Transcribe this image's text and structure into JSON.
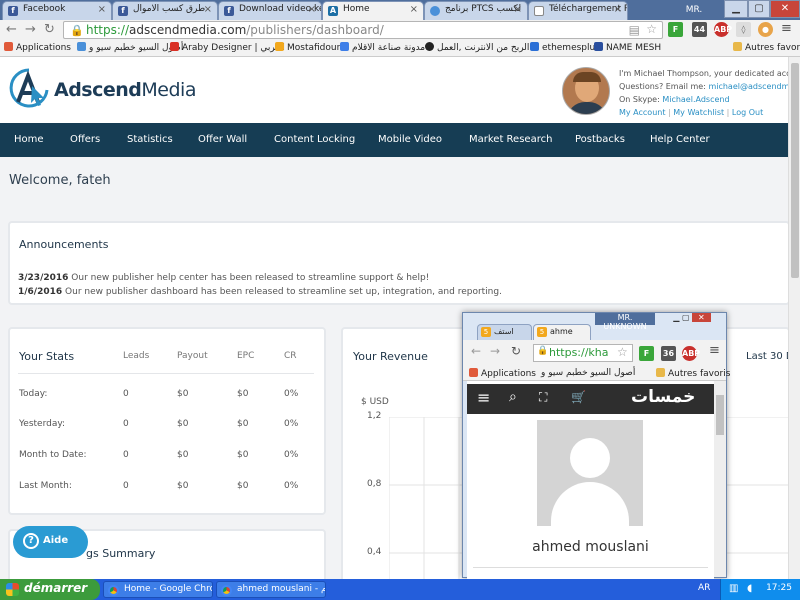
{
  "browser": {
    "tabs": [
      {
        "title": "Facebook",
        "icon": "facebook-icon",
        "color": "#3b5998"
      },
      {
        "title": "طرق كسب الاموال",
        "icon": "facebook-icon",
        "color": "#3b5998"
      },
      {
        "title": "Download video ke",
        "icon": "facebook-icon",
        "color": "#3b5998"
      },
      {
        "title": "Home",
        "icon": "adscend-icon",
        "color": "#1d6fa5"
      },
      {
        "title": "برنامج PTCS لكسب",
        "icon": "globe-icon",
        "color": "#4a90d9"
      },
      {
        "title": "Téléchargement PT",
        "icon": "page-icon",
        "color": "#888888"
      }
    ],
    "user_badge": "MR. UNKNOWN",
    "url_scheme": "https://",
    "url_host": "adscendmedia.com",
    "url_path": "/publishers/dashboard/",
    "extensions": [
      {
        "label": "F",
        "color": "#3aa63a"
      },
      {
        "label": "44",
        "color": "#555555"
      },
      {
        "label": "ABP",
        "color": "#c9302c"
      }
    ],
    "bookmarks": [
      {
        "label": "Applications",
        "color": "#e05a3a"
      },
      {
        "label": "أصول السيو خطبم سيو و",
        "color": "#4a90d9"
      },
      {
        "label": "Araby Designer | العربي",
        "color": "#d93025"
      },
      {
        "label": "Mostafidoun",
        "color": "#f2a81d"
      },
      {
        "label": "مدونة صناعة الاقلام",
        "color": "#3d7ee8"
      },
      {
        "label": "الربح من الانترنت ,العمل",
        "color": "#222222"
      },
      {
        "label": "ethemesplus",
        "color": "#2a6fd6"
      },
      {
        "label": "NAME MESH",
        "color": "#2a4f9e"
      },
      {
        "label": "Autres favoris",
        "color": "#e8b84a"
      }
    ]
  },
  "site": {
    "logo_brand": "Adscend",
    "logo_media": "Media",
    "manager": {
      "intro": "I'm Michael Thompson, your dedicated account",
      "email_label": "Questions? Email me:",
      "email": "michael@adscendmedia.",
      "skype_label": "On Skype:",
      "skype": "Michael.Adscend",
      "links": [
        "My Account",
        "My Watchlist",
        "Log Out"
      ]
    },
    "nav": [
      "Home",
      "Offers",
      "Statistics",
      "Offer Wall",
      "Content Locking",
      "Mobile Video",
      "Market Research",
      "Postbacks",
      "Help Center"
    ],
    "welcome": "Welcome, fateh",
    "announcements": {
      "title": "Announcements",
      "items": [
        {
          "date": "3/23/2016",
          "text": "Our new publisher help center has been released to streamline support & help!"
        },
        {
          "date": "1/6/2016",
          "text": "Our new publisher dashboard has been released to streamline set up, integration, and reporting."
        }
      ]
    },
    "stats": {
      "title": "Your Stats",
      "columns": [
        "Leads",
        "Payout",
        "EPC",
        "CR"
      ],
      "rows": [
        {
          "label": "Today:",
          "values": [
            "0",
            "$0",
            "$0",
            "0%"
          ]
        },
        {
          "label": "Yesterday:",
          "values": [
            "0",
            "$0",
            "$0",
            "0%"
          ]
        },
        {
          "label": "Month to Date:",
          "values": [
            "0",
            "$0",
            "$0",
            "0%"
          ]
        },
        {
          "label": "Last Month:",
          "values": [
            "0",
            "$0",
            "$0",
            "0%"
          ]
        }
      ]
    },
    "revenue": {
      "title": "Your Revenue",
      "range": "Last 30 D",
      "unit": "$ USD",
      "ticks": [
        "1,2",
        "0,8",
        "0,4"
      ]
    },
    "earnings_title_fragment": "gs Summary",
    "aide": "Aide"
  },
  "popup": {
    "tabs": [
      "استف",
      "ahme"
    ],
    "user_badge": "MR. UNKNOWN",
    "url": "https://kha",
    "bookmarks": [
      "Applications",
      "أصول السيو خطبم سيو و",
      "Autres favoris"
    ],
    "brand": "خمسات",
    "profile_name": "ahmed mouslani"
  },
  "taskbar": {
    "start": "démarrer",
    "tasks": [
      "Home - Google Chrome",
      "ahmed mouslani - خم..."
    ],
    "lang": "AR",
    "clock": "17:25"
  }
}
